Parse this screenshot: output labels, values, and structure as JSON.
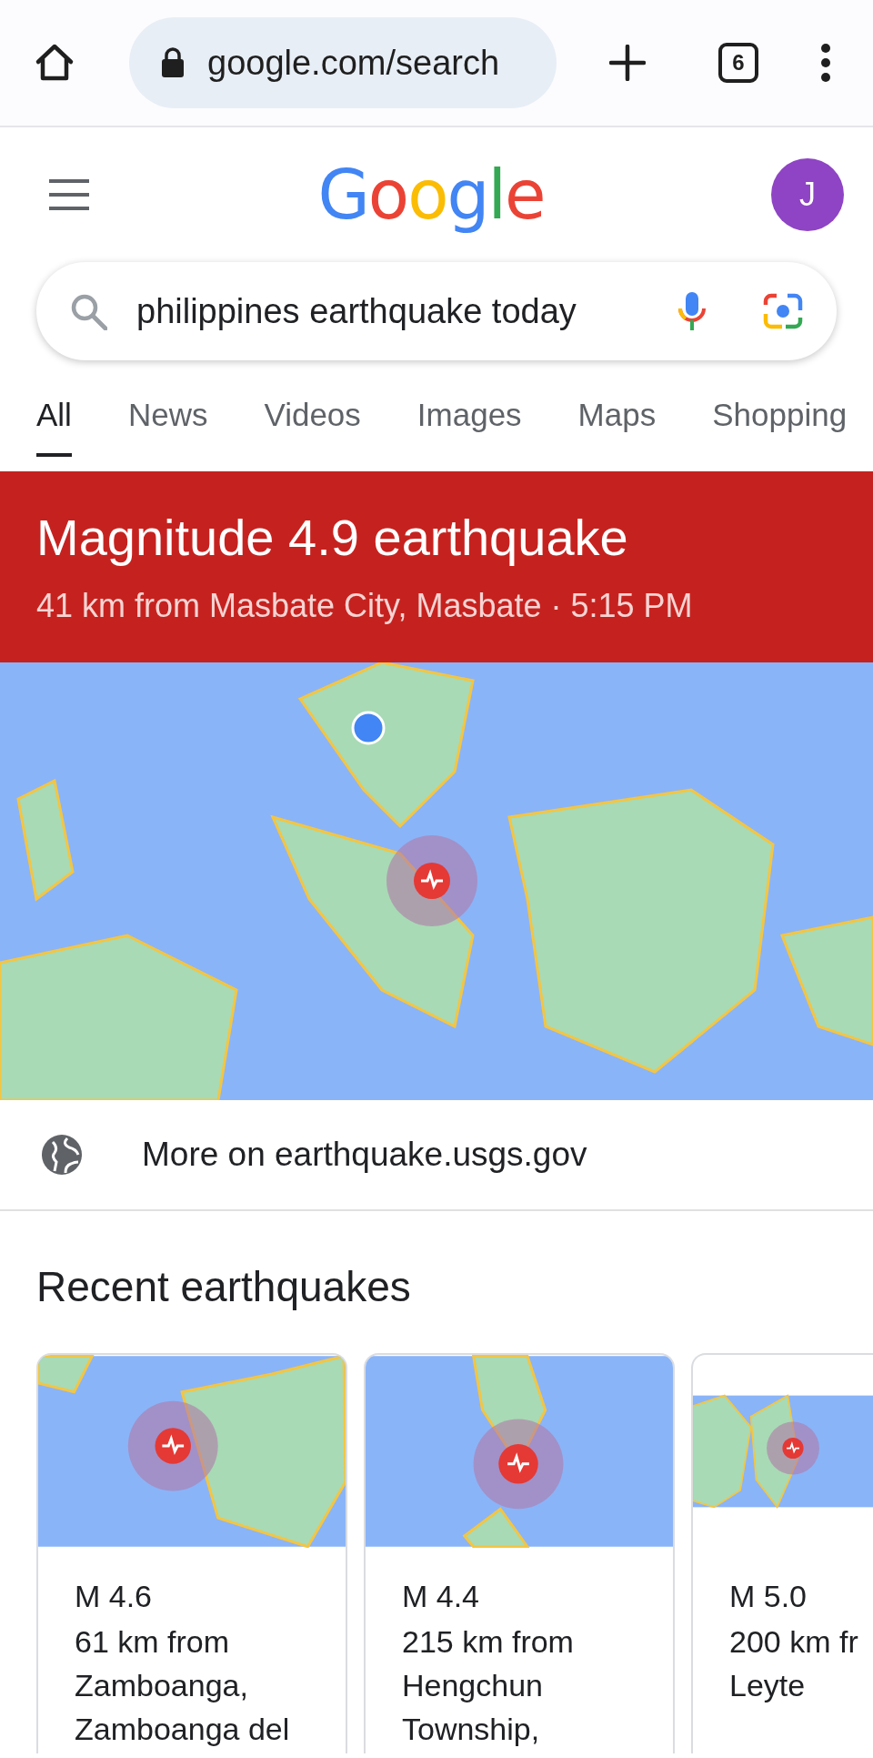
{
  "browser": {
    "url": "google.com/search",
    "tab_count": "6"
  },
  "header": {
    "logo": "Google",
    "avatar": "J"
  },
  "search": {
    "value": "philippines earthquake today"
  },
  "tabs": [
    {
      "label": "All",
      "selected": true
    },
    {
      "label": "News",
      "selected": false
    },
    {
      "label": "Videos",
      "selected": false
    },
    {
      "label": "Images",
      "selected": false
    },
    {
      "label": "Maps",
      "selected": false
    },
    {
      "label": "Shopping",
      "selected": false
    }
  ],
  "alert": {
    "title": "Magnitude 4.9 earthquake",
    "subtitle": "41 km from Masbate City, Masbate · 5:15 PM"
  },
  "source_link": "More on earthquake.usgs.gov",
  "recent": {
    "heading": "Recent earthquakes",
    "cards": [
      {
        "magnitude": "M 4.6",
        "location_lines": [
          "61 km from",
          "Zamboanga,",
          "Zamboanga del"
        ]
      },
      {
        "magnitude": "M 4.4",
        "location_lines": [
          "215 km from",
          "Hengchun",
          "Township,"
        ]
      },
      {
        "magnitude": "M 5.0",
        "location_lines": [
          "200 km fr",
          "Leyte"
        ]
      }
    ]
  }
}
